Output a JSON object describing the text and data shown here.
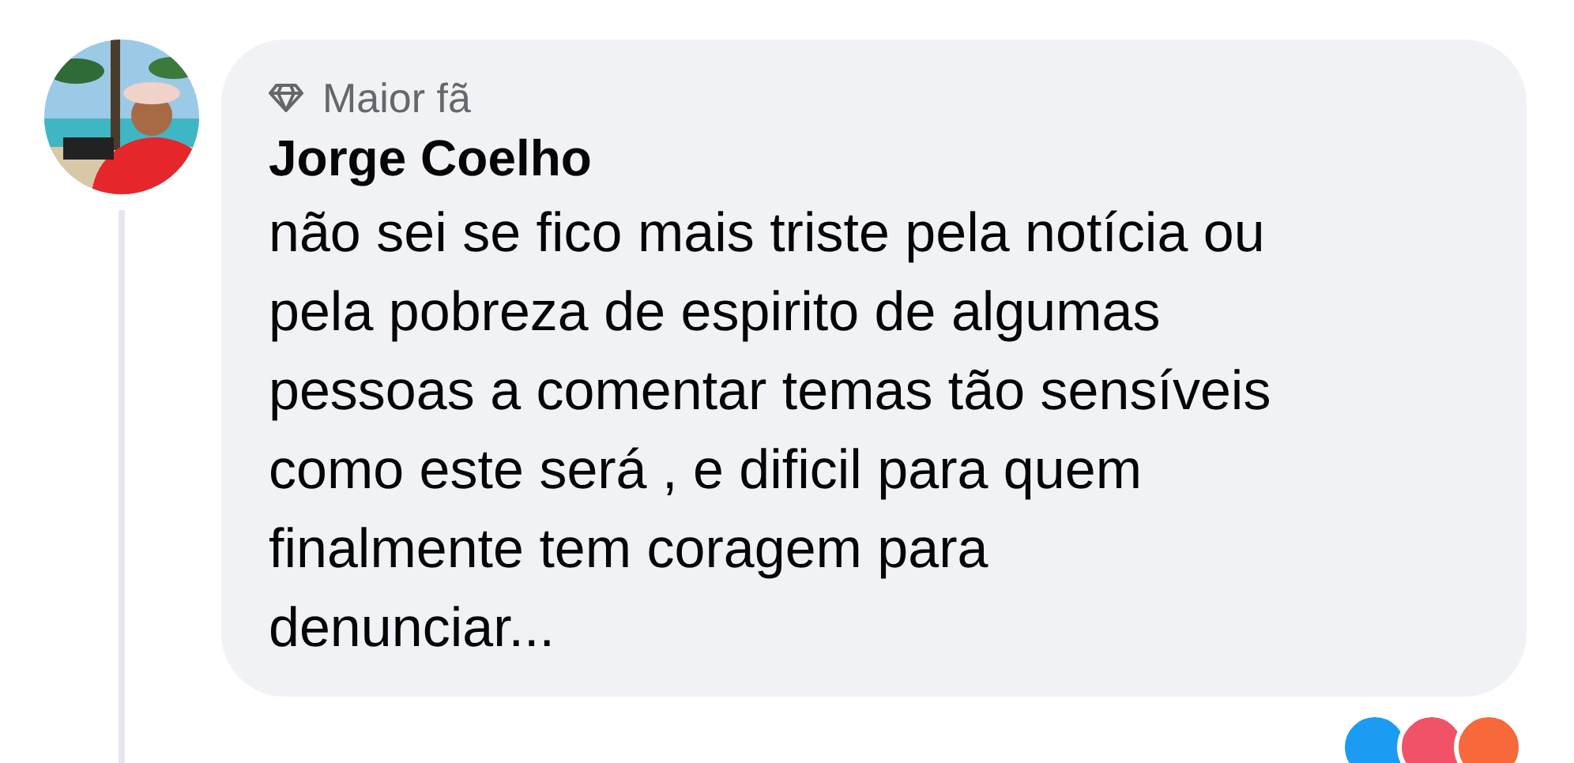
{
  "comment": {
    "badge": "Maior fã",
    "author": "Jorge Coelho",
    "text": "não sei se fico mais triste pela notícia ou\npela pobreza de espirito de algumas\npessoas a comentar temas tão sensíveis\ncomo este será , e dificil para quem\nfinalmente tem coragem para\ndenunciar...",
    "reactions": [
      {
        "color": "#1b9cf2"
      },
      {
        "color": "#f25268"
      },
      {
        "color": "#f7683a"
      }
    ]
  }
}
